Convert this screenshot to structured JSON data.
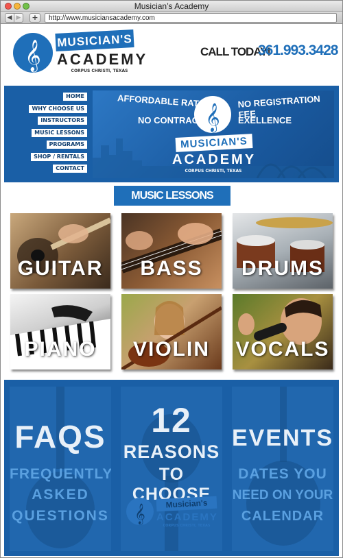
{
  "window": {
    "title": "Musician’s Academy"
  },
  "toolbar": {
    "back": "◀",
    "forward": "▶",
    "add": "+"
  },
  "url": "http://www.musiciansacademy.com",
  "header": {
    "logo_line1": "MUSICIAN'S",
    "logo_line2": "ACADEMY",
    "logo_line3": "CORPUS CHRISTI, TEXAS",
    "call_text": "CALL TODAY!",
    "phone": "361.993.3428"
  },
  "nav": {
    "items": [
      "HOME",
      "WHY CHOOSE US",
      "INSTRUCTORS",
      "MUSIC LESSONS",
      "PROGRAMS",
      "SHOP / RENTALS",
      "CONTACT"
    ]
  },
  "banner": {
    "tag1": "AFFORDABLE RATES",
    "tag2": "NO CONTRACT",
    "tag3": "NO REGISTRATION FEE",
    "tag4": "EXELLENCE",
    "logo_line1": "MUSICIAN'S",
    "logo_line2": "ACADEMY",
    "logo_line3": "CORPUS CHRISTI, TEXAS"
  },
  "lessons": {
    "heading": "MUSIC LESSONS",
    "tiles": [
      {
        "label": "GUITAR",
        "icon": "guitar-icon"
      },
      {
        "label": "BASS",
        "icon": "bass-icon"
      },
      {
        "label": "DRUMS",
        "icon": "drums-icon"
      },
      {
        "label": "PIANO",
        "icon": "piano-icon"
      },
      {
        "label": "VIOLIN",
        "icon": "violin-icon"
      },
      {
        "label": "VOCALS",
        "icon": "microphone-icon"
      }
    ]
  },
  "promos": {
    "faqs": {
      "title": "FAQS",
      "line1": "FREQUENTLY",
      "line2": "ASKED",
      "line3": "QUESTIONS"
    },
    "reasons": {
      "number": "12",
      "line1": "REASONS",
      "line2": "TO CHOOSE",
      "logo_line1": "Musician's",
      "logo_line2": "ACADEMY",
      "logo_line3": "CORPUS CHRISTI, TEXAS"
    },
    "events": {
      "title": "EVENTS",
      "line1": "DATES YOU",
      "line2": "NEED ON YOUR",
      "line3": "CALENDAR"
    }
  },
  "colors": {
    "brand": "#1f6fb9",
    "dark_blue": "#0d3c6e",
    "phone_blue": "#1f6fb9"
  }
}
